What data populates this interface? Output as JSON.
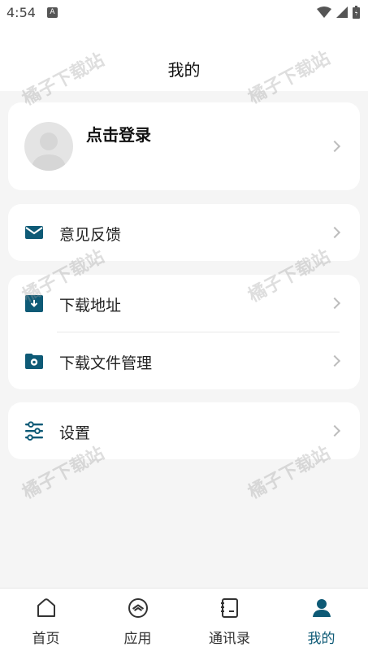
{
  "status_bar": {
    "time": "4:54",
    "notification_letter": "A"
  },
  "header": {
    "title": "我的"
  },
  "profile": {
    "login_label": "点击登录"
  },
  "menu": {
    "feedback": "意见反馈",
    "download_path": "下载地址",
    "download_manager": "下载文件管理",
    "settings": "设置"
  },
  "tabs": [
    {
      "label": "首页",
      "icon": "home-icon"
    },
    {
      "label": "应用",
      "icon": "apps-icon"
    },
    {
      "label": "通讯录",
      "icon": "contacts-icon"
    },
    {
      "label": "我的",
      "icon": "profile-icon"
    }
  ],
  "watermark": "橘子下载站",
  "colors": {
    "accent": "#0e5a76",
    "background": "#f5f5f5",
    "card": "#ffffff"
  }
}
